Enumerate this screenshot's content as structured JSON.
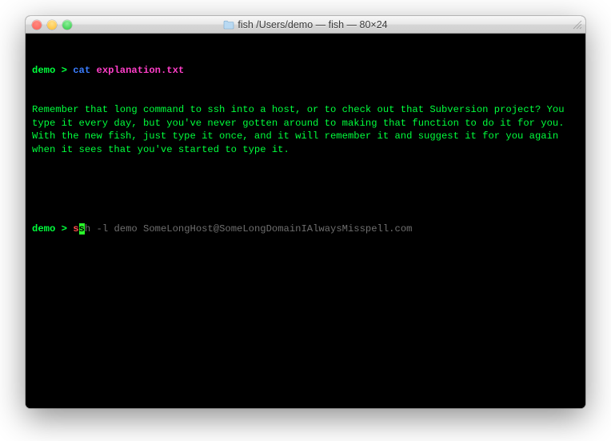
{
  "window": {
    "title": "fish  /Users/demo — fish — 80×24"
  },
  "prompt": {
    "user": "demo",
    "separator": " > "
  },
  "line1": {
    "command": "cat",
    "argument": "explanation.txt"
  },
  "output": {
    "text": "Remember that long command to ssh into a host, or to check out that Subversion project? You type it every day, but you've never gotten around to making that function to do it for you. With the new fish, just type it once, and it will remember it and suggest it for you again when it sees that you've started to type it."
  },
  "line2": {
    "typed_before_cursor": "s",
    "cursor_char": "s",
    "suggestion_rest": "h -l demo SomeLongHost@SomeLongDomainIAlwaysMisspell.com"
  }
}
